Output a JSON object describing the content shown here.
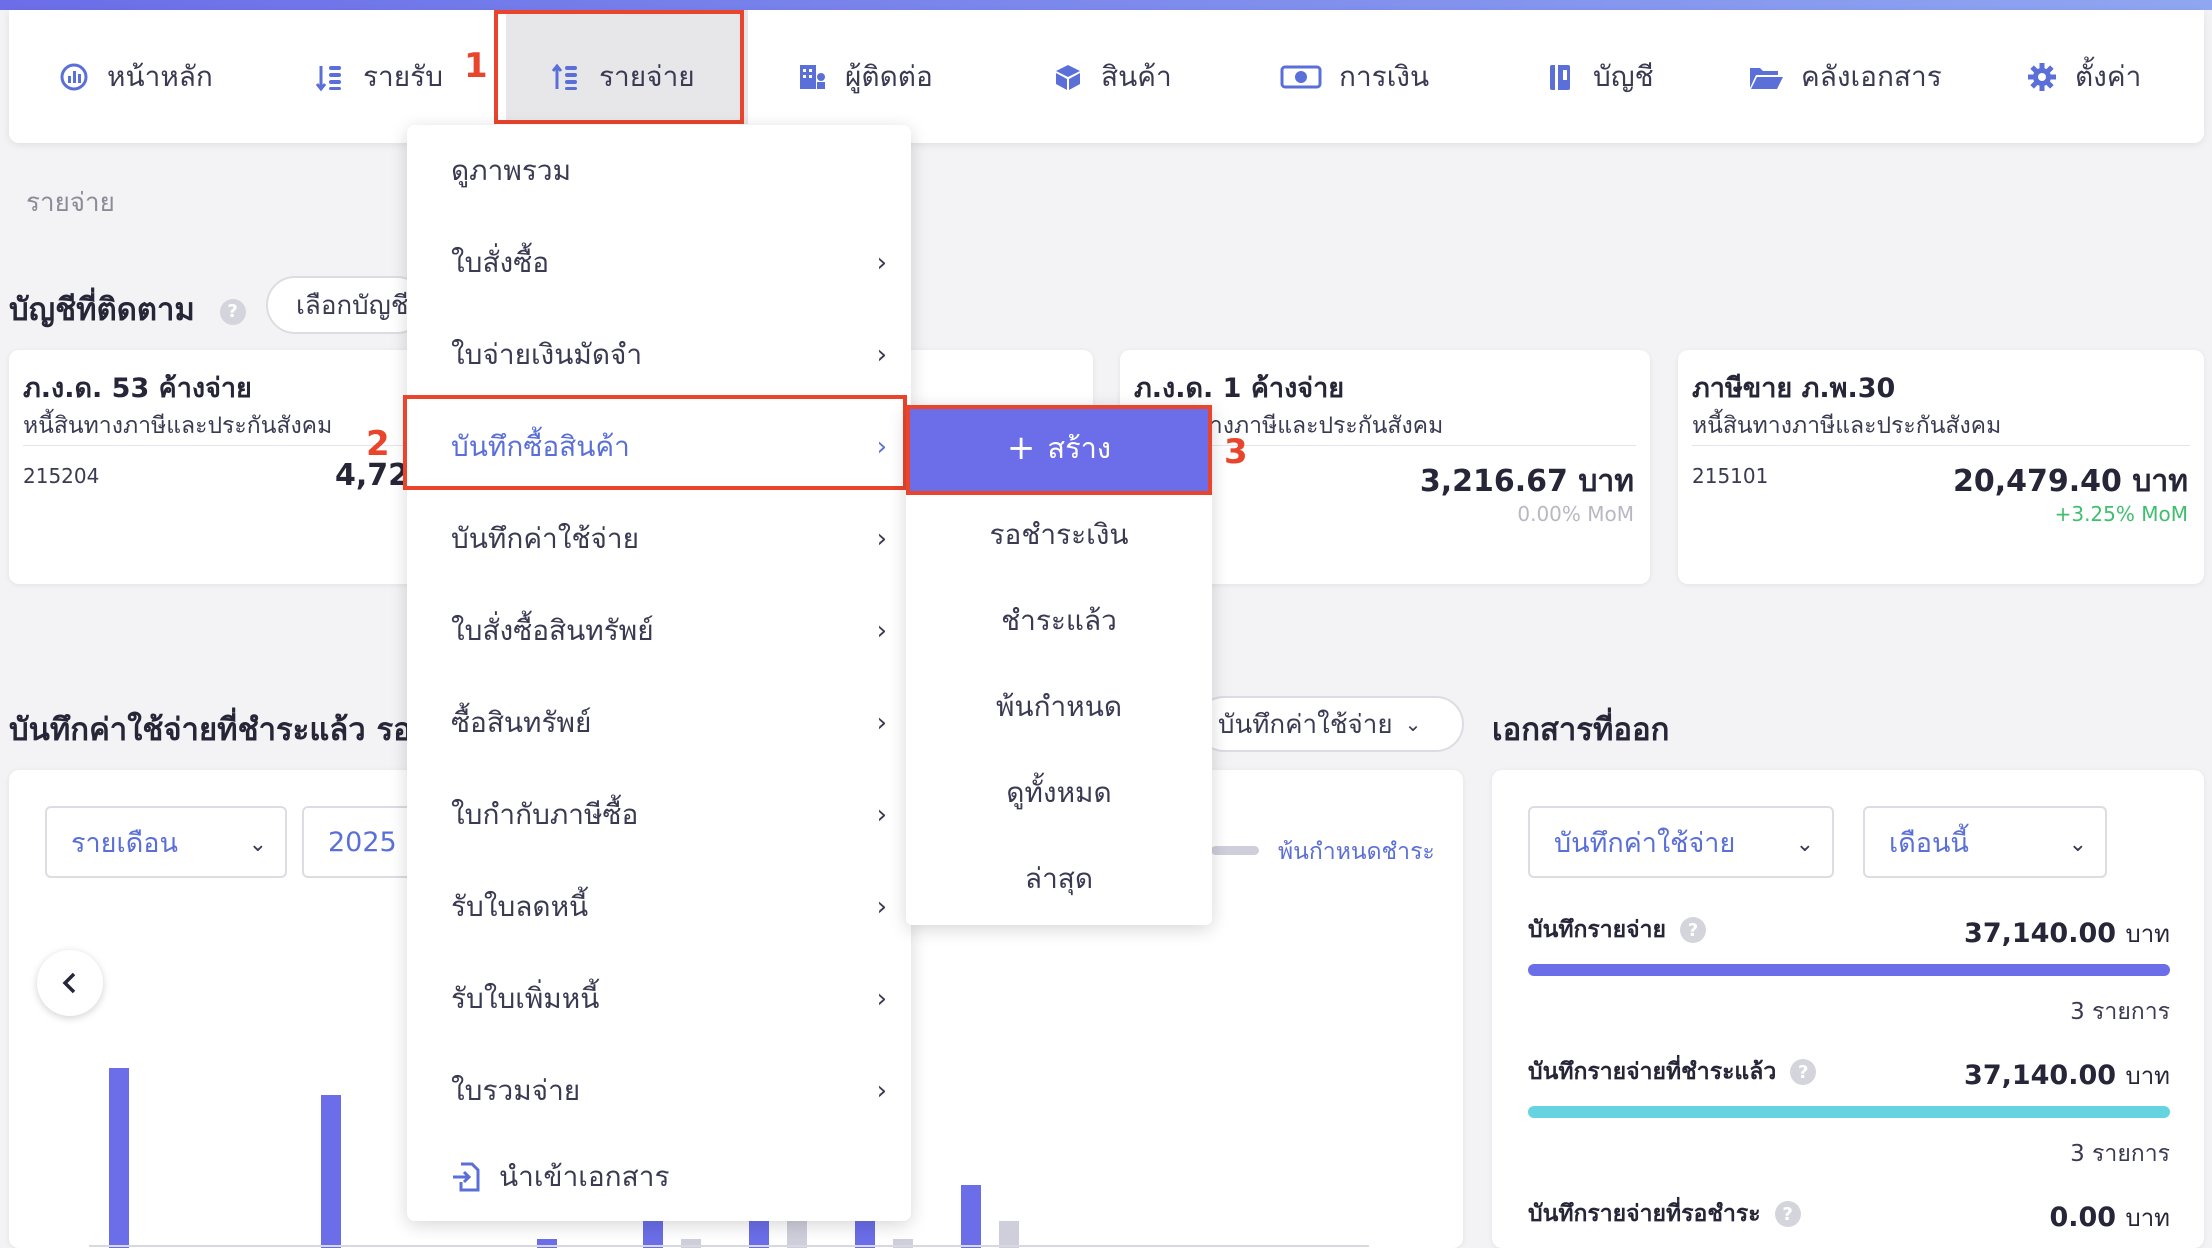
{
  "nav": {
    "items": [
      {
        "label": "หน้าหลัก",
        "icon": "dashboard-icon"
      },
      {
        "label": "รายรับ",
        "icon": "income-icon"
      },
      {
        "label": "รายจ่าย",
        "icon": "expense-icon"
      },
      {
        "label": "ผู้ติดต่อ",
        "icon": "contacts-icon"
      },
      {
        "label": "สินค้า",
        "icon": "box-icon"
      },
      {
        "label": "การเงิน",
        "icon": "money-icon"
      },
      {
        "label": "บัญชี",
        "icon": "ledger-icon"
      },
      {
        "label": "คลังเอกสาร",
        "icon": "folder-icon"
      },
      {
        "label": "ตั้งค่า",
        "icon": "gear-icon"
      }
    ],
    "active": "รายจ่าย"
  },
  "annotations": [
    "1",
    "2",
    "3"
  ],
  "page_title": "รายจ่าย",
  "watched": {
    "title": "บัญชีที่ติดตาม",
    "select_button": "เลือกบัญชี",
    "help": "?"
  },
  "cards": [
    {
      "title": "ภ.ง.ด. 53 ค้างจ่าย",
      "subtitle": "หนี้สินทางภาษีและประกันสังคม",
      "code": "215204",
      "amount": "4,72",
      "mom": ""
    },
    {
      "title": "ภ.ง.ด. 1 ค้างจ่าย",
      "subtitle": "หนี้สินทางภาษีและประกันสังคม",
      "code": "",
      "amount": "3,216.67 บาท",
      "mom": "0.00% MoM"
    },
    {
      "title": "ภาษีขาย ภ.พ.30",
      "subtitle": "หนี้สินทางภาษีและประกันสังคม",
      "code": "215101",
      "amount": "20,479.40 บาท",
      "mom": "+3.25% MoM"
    }
  ],
  "chart_section": {
    "title": "บันทึกค่าใช้จ่ายที่ชำระแล้ว รอชำ",
    "type_select": "บันทึกค่าใช้จ่าย",
    "period_select": "รายเดือน",
    "year_select": "2025",
    "legend_overdue": "พ้นกำหนดชำระ",
    "prev_icon": "chevron-left-icon"
  },
  "chart_data": {
    "type": "bar",
    "series": [
      {
        "values": [
          20,
          17,
          1,
          5,
          9,
          8,
          7
        ]
      },
      {
        "values": [
          0,
          0,
          0,
          1,
          3,
          1,
          3
        ]
      }
    ],
    "colors": [
      "#6b6ee8",
      "#cfcfdc"
    ]
  },
  "docs": {
    "title": "เอกสารที่ออก",
    "type_select": "บันทึกค่าใช้จ่าย",
    "period_select": "เดือนนี้",
    "stats": [
      {
        "label": "บันทึกรายจ่าย",
        "value": "37,140.00",
        "unit": "บาท",
        "count": "3 รายการ",
        "color": "#6b6ee8",
        "fill": 1.0
      },
      {
        "label": "บันทึกรายจ่ายที่ชำระแล้ว",
        "value": "37,140.00",
        "unit": "บาท",
        "count": "3 รายการ",
        "color": "#66d4e0",
        "fill": 1.0
      },
      {
        "label": "บันทึกรายจ่ายที่รอชำระ",
        "value": "0.00",
        "unit": "บาท"
      }
    ]
  },
  "menu": {
    "items": [
      {
        "label": "ดูภาพรวม",
        "has_sub": false
      },
      {
        "label": "ใบสั่งซื้อ",
        "has_sub": true
      },
      {
        "label": "ใบจ่ายเงินมัดจำ",
        "has_sub": true
      },
      {
        "label": "บันทึกซื้อสินค้า",
        "has_sub": true
      },
      {
        "label": "บันทึกค่าใช้จ่าย",
        "has_sub": true
      },
      {
        "label": "ใบสั่งซื้อสินทรัพย์",
        "has_sub": true
      },
      {
        "label": "ซื้อสินทรัพย์",
        "has_sub": true
      },
      {
        "label": "ใบกำกับภาษีซื้อ",
        "has_sub": true
      },
      {
        "label": "รับใบลดหนี้",
        "has_sub": true
      },
      {
        "label": "รับใบเพิ่มหนี้",
        "has_sub": true
      },
      {
        "label": "ใบรวมจ่าย",
        "has_sub": true
      }
    ],
    "import_label": "นำเข้าเอกสาร",
    "active_index": 3
  },
  "submenu": {
    "create_label": "สร้าง",
    "items": [
      "รอชำระเงิน",
      "ชำระแล้ว",
      "พ้นกำหนด",
      "ดูทั้งหมด",
      "ล่าสุด"
    ]
  }
}
